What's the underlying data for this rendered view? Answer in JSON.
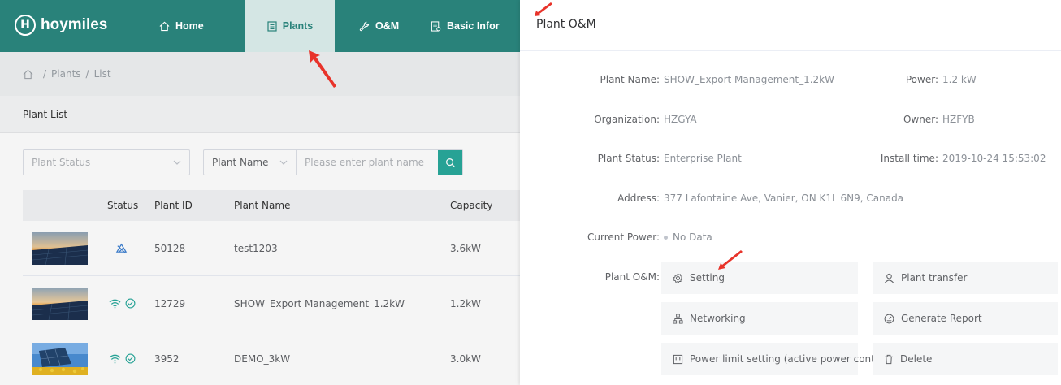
{
  "brand": {
    "logo_letter": "H",
    "name": "hoymiles"
  },
  "nav": {
    "items": [
      {
        "label": "Home",
        "icon": "home-icon"
      },
      {
        "label": "Plants",
        "icon": "document-icon",
        "active": true
      },
      {
        "label": "O&M",
        "icon": "wrench-icon"
      },
      {
        "label": "Basic Infor",
        "icon": "info-doc-icon"
      }
    ]
  },
  "breadcrumb": {
    "items": [
      "Plants",
      "List"
    ],
    "separator": "/"
  },
  "list_title": "Plant List",
  "filters": {
    "status_placeholder": "Plant Status",
    "field_select": "Plant Name",
    "search_placeholder": "Please enter plant name"
  },
  "table": {
    "headers": [
      "Status",
      "Plant ID",
      "Plant Name",
      "Capacity"
    ],
    "rows": [
      {
        "status": "offline",
        "id": "50128",
        "name": "test1203",
        "capacity": "3.6kW"
      },
      {
        "status": "online",
        "id": "12729",
        "name": "SHOW_Export Management_1.2kW",
        "capacity": "1.2kW"
      },
      {
        "status": "online",
        "id": "3952",
        "name": "DEMO_3kW",
        "capacity": "3.0kW"
      }
    ]
  },
  "drawer": {
    "title": "Plant O&M",
    "fields": {
      "plant_name": {
        "label": "Plant Name",
        "value": "SHOW_Export Management_1.2kW"
      },
      "power": {
        "label": "Power",
        "value": "1.2 kW"
      },
      "organization": {
        "label": "Organization",
        "value": "HZGYA"
      },
      "owner": {
        "label": "Owner",
        "value": "HZFYB"
      },
      "plant_status": {
        "label": "Plant Status",
        "value": "Enterprise Plant"
      },
      "install_time": {
        "label": "Install time",
        "value": "2019-10-24 15:53:02"
      },
      "address": {
        "label": "Address",
        "value": "377 Lafontaine Ave, Vanier, ON K1L 6N9, Canada"
      },
      "current_power": {
        "label": "Current Power",
        "value": "No Data"
      }
    },
    "om_label": "Plant O&M",
    "om_buttons": {
      "setting": "Setting",
      "plant_transfer": "Plant transfer",
      "networking": "Networking",
      "generate_report": "Generate Report",
      "power_limit": "Power limit setting (active power control)",
      "delete": "Delete"
    }
  },
  "colors": {
    "brand": "#29827a",
    "accent": "#29a99c",
    "annotation": "#e8332a"
  }
}
